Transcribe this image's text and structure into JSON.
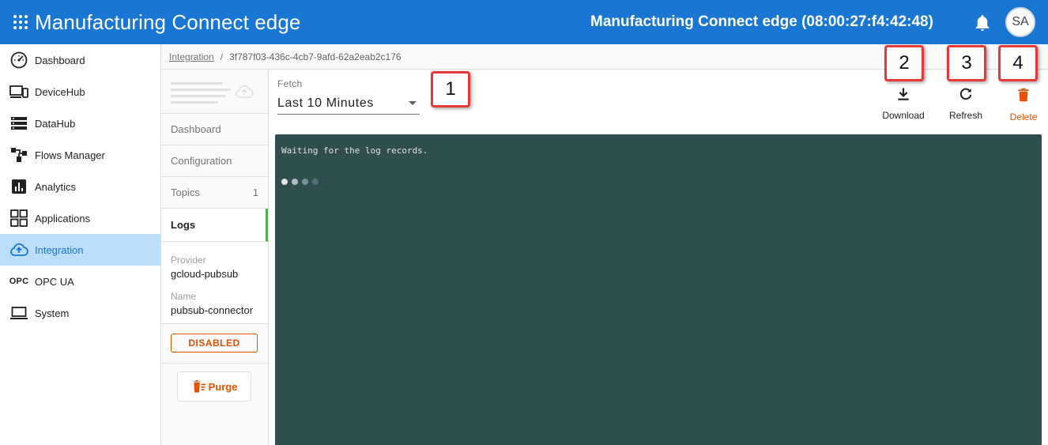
{
  "app": {
    "title": "Manufacturing Connect edge",
    "device_title": "Manufacturing Connect edge (08:00:27:f4:42:48)",
    "avatar_initials": "SA",
    "accent": "#1976d2"
  },
  "nav": {
    "items": [
      {
        "label": "Dashboard",
        "icon": "speedometer-icon"
      },
      {
        "label": "DeviceHub",
        "icon": "devices-icon"
      },
      {
        "label": "DataHub",
        "icon": "storage-icon"
      },
      {
        "label": "Flows Manager",
        "icon": "flows-icon"
      },
      {
        "label": "Analytics",
        "icon": "analytics-icon"
      },
      {
        "label": "Applications",
        "icon": "apps-grid-icon"
      },
      {
        "label": "Integration",
        "icon": "cloud-upload-icon",
        "active": true
      },
      {
        "label": "OPC UA",
        "icon": "opc-icon",
        "icon_text": "OPC"
      },
      {
        "label": "System",
        "icon": "laptop-icon"
      }
    ]
  },
  "breadcrumb": {
    "parent": "Integration",
    "separator": "/",
    "current": "3f787f03-436c-4cb7-9afd-62a2eab2c176"
  },
  "subnav": {
    "tabs": [
      {
        "label": "Dashboard",
        "count": ""
      },
      {
        "label": "Configuration",
        "count": ""
      },
      {
        "label": "Topics",
        "count": "1"
      },
      {
        "label": "Logs",
        "count": "",
        "active": true
      }
    ],
    "provider_label": "Provider",
    "provider_value": "gcloud-pubsub",
    "name_label": "Name",
    "name_value": "pubsub-connector",
    "status": "DISABLED",
    "status_color": "#e65100",
    "purge_label": "Purge"
  },
  "logs": {
    "fetch_label": "Fetch",
    "fetch_value": "Last 10 Minutes",
    "actions": {
      "download": "Download",
      "refresh": "Refresh",
      "delete": "Delete"
    },
    "console_message": "Waiting for the log records.",
    "console_bg": "#2f4f4f"
  },
  "callouts": [
    "1",
    "2",
    "3",
    "4"
  ]
}
